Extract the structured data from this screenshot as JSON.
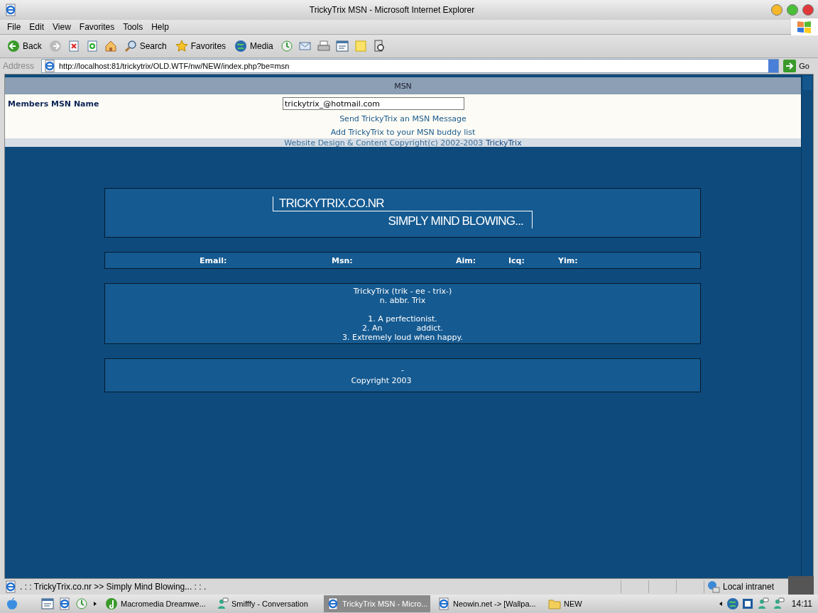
{
  "window": {
    "title": "TrickyTrix MSN - Microsoft Internet Explorer"
  },
  "menu": [
    "File",
    "Edit",
    "View",
    "Favorites",
    "Tools",
    "Help"
  ],
  "toolbar": [
    {
      "kind": "back",
      "label": "Back"
    },
    {
      "kind": "forward"
    },
    {
      "kind": "stop"
    },
    {
      "kind": "refresh"
    },
    {
      "kind": "home"
    },
    {
      "kind": "search",
      "label": "Search"
    },
    {
      "kind": "favorites",
      "label": "Favorites"
    },
    {
      "kind": "media",
      "label": "Media"
    },
    {
      "kind": "history"
    },
    {
      "kind": "mail"
    },
    {
      "kind": "print"
    },
    {
      "kind": "edit"
    },
    {
      "kind": "note"
    },
    {
      "kind": "research"
    }
  ],
  "address": {
    "label": "Address",
    "value": "http://localhost:81/trickytrix/OLD.WTF/nw/NEW/index.php?be=msn",
    "go": "Go"
  },
  "page": {
    "header": "MSN",
    "field_label": "Members MSN Name",
    "field_value": "trickytrix_@hotmail.com",
    "links": [
      "Send TrickyTrix an MSN Message",
      "Add TrickyTrix to your MSN buddy list"
    ],
    "copyright": "Website Design & Content Copyright(c) 2002-2003",
    "copyright_link": "TrickyTrix",
    "logo": {
      "title": "TRICKYTRIX.CO.NR",
      "tagline": "SIMPLY MIND BLOWING..."
    },
    "contacts": [
      "Email:",
      "Msn:",
      "Aim:",
      "Icq:",
      "Yim:"
    ],
    "definition": [
      "TrickyTrix (trik - ee - trix-)",
      "n. abbr. Trix",
      "1. A perfectionist.",
      "2. An",
      "addict.",
      "3. Extremely loud when happy."
    ],
    "footer": {
      "dash": "-",
      "copyright": "Copyright 2003"
    }
  },
  "status_bar": {
    "text": ". : : TrickyTrix.co.nr >> Simply Mind Blowing... : : .",
    "zone": "Local intranet"
  },
  "taskbar": {
    "tasks": [
      {
        "label": "Macromedia Dreamwe...",
        "selected": false,
        "kind": "dreamweaver"
      },
      {
        "label": "Smifffy - Conversation",
        "selected": false,
        "kind": "messenger"
      },
      {
        "label": "TrickyTrix MSN - Micro...",
        "selected": true,
        "kind": "ie"
      },
      {
        "label": "Neowin.net -> [Wallpa...",
        "selected": false,
        "kind": "ie"
      },
      {
        "label": "NEW",
        "selected": false,
        "kind": "folder"
      }
    ],
    "clock": "14:11"
  }
}
